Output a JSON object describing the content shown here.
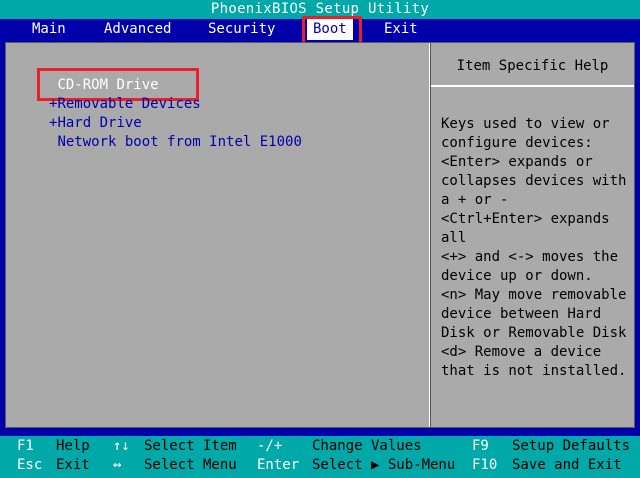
{
  "window": {
    "title": "PhoenixBIOS Setup Utility"
  },
  "menu": {
    "items": [
      {
        "label": "Main",
        "active": false
      },
      {
        "label": "Advanced",
        "active": false
      },
      {
        "label": "Security",
        "active": false
      },
      {
        "label": "Boot",
        "active": true
      },
      {
        "label": "Exit",
        "active": false
      }
    ]
  },
  "boot": {
    "items": [
      {
        "label": "CD-ROM Drive",
        "prefix": " ",
        "selected": true
      },
      {
        "label": "Removable Devices",
        "prefix": "+",
        "selected": false
      },
      {
        "label": "Hard Drive",
        "prefix": "+",
        "selected": false
      },
      {
        "label": "Network boot from Intel E1000",
        "prefix": " ",
        "selected": false
      }
    ]
  },
  "help": {
    "title": "Item Specific Help",
    "lines": [
      "Keys used to view or",
      "configure devices:",
      "<Enter> expands or",
      "collapses devices with",
      "a + or -",
      "<Ctrl+Enter> expands",
      "all",
      "<+> and <-> moves the",
      "device up or down.",
      "<n> May move removable",
      "device between Hard",
      "Disk or Removable Disk",
      "<d> Remove a device",
      "that is not installed."
    ]
  },
  "footer": {
    "row1": [
      {
        "key": "F1",
        "desc": "Help"
      },
      {
        "key": "↑↓",
        "desc": "Select Item"
      },
      {
        "key": "-/+",
        "desc": "Change Values"
      },
      {
        "key": "F9",
        "desc": "Setup Defaults"
      }
    ],
    "row2": [
      {
        "key": "Esc",
        "desc": "Exit"
      },
      {
        "key": "↔",
        "desc": "Select Menu"
      },
      {
        "key": "Enter",
        "desc": "Select ▶ Sub-Menu"
      },
      {
        "key": "F10",
        "desc": "Save and Exit"
      }
    ]
  },
  "colors": {
    "background": "#0000aa",
    "title_bar": "#00a8a8",
    "panel": "#aaaaaa",
    "highlight_box": "#e8202a"
  }
}
